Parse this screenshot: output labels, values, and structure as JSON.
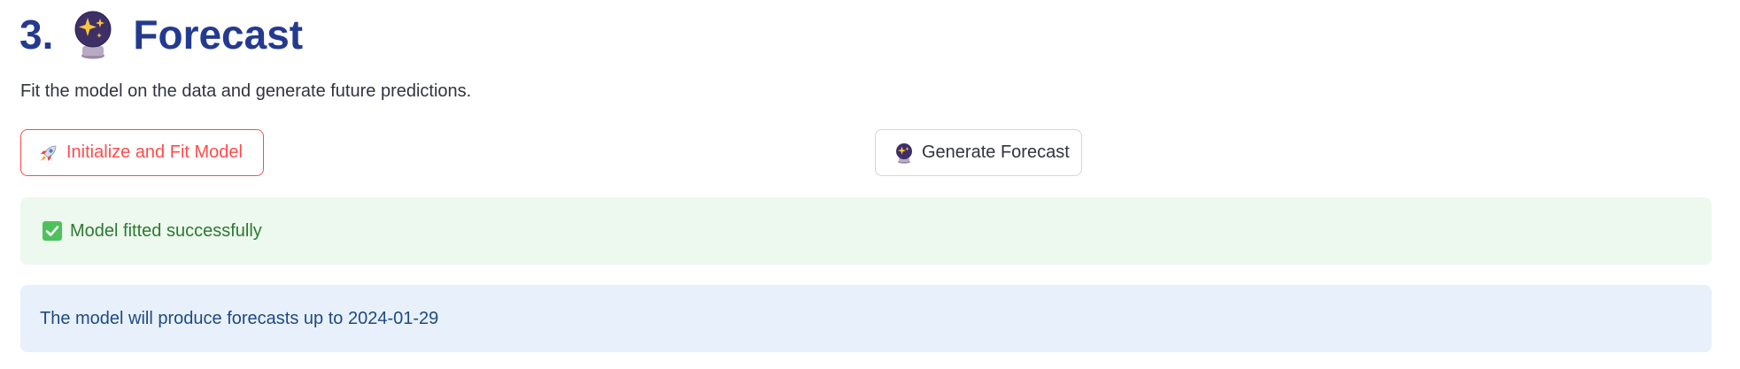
{
  "section": {
    "number": "3.",
    "title": "Forecast",
    "icon": "crystal-ball-icon",
    "description": "Fit the model on the data and generate future predictions."
  },
  "buttons": {
    "fit_label": "Initialize and Fit Model",
    "fit_icon": "rocket-icon",
    "forecast_label": "Generate Forecast",
    "forecast_icon": "crystal-ball-icon"
  },
  "alerts": {
    "success_text": "Model fitted successfully",
    "success_icon": "check-box-icon",
    "info_text": "The model will produce forecasts up to 2024-01-29"
  },
  "colors": {
    "title": "#243a8f",
    "primary_accent": "#ff4b4b",
    "success_bg": "#edf8ee",
    "success_text": "#2b7a2f",
    "info_bg": "#e8f0fb",
    "info_text": "#1d4a84"
  }
}
